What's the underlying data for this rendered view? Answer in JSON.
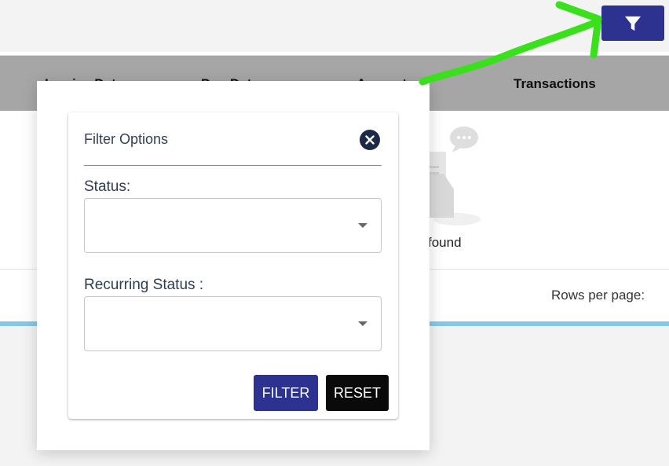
{
  "toolbar": {
    "filter_icon": "filter-funnel-icon",
    "accent": "#2d3190"
  },
  "table": {
    "columns": [
      "Invoice Date",
      "Due Date",
      "Amount",
      "Transactions"
    ],
    "empty_text": "No data found",
    "empty_text_visible": "found"
  },
  "pagination": {
    "rows_per_page_label": "Rows per page:"
  },
  "filter_dialog": {
    "title": "Filter Options",
    "close_icon": "close-circle-icon",
    "status_label": "Status:",
    "status_value": "",
    "recurring_label": "Recurring Status :",
    "recurring_value": "",
    "filter_button": "FILTER",
    "reset_button": "RESET"
  },
  "colors": {
    "primary": "#2d3190",
    "header_bg": "#a6a6a6",
    "blue_line": "#87c7e6",
    "annotation_arrow": "#39e01b"
  }
}
